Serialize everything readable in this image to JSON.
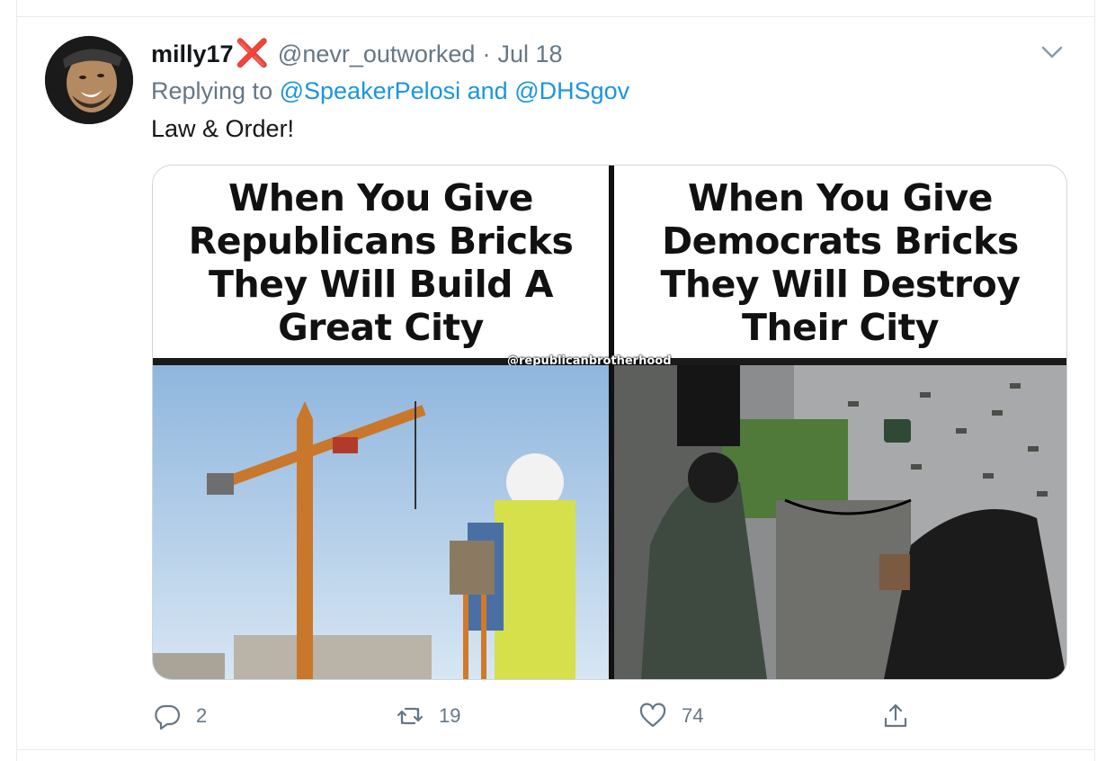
{
  "tweet": {
    "display_name": "milly17",
    "name_emoji": "❌",
    "handle": "@nevr_outworked",
    "separator": "·",
    "date": "Jul 18",
    "replying_prefix": "Replying to",
    "reply_to_1": "@SpeakerPelosi",
    "reply_joiner": "and",
    "reply_to_2": "@DHSgov",
    "text": "Law & Order!"
  },
  "media": {
    "left_caption": "When You Give\nRepublicans Bricks\nThey Will Build A\nGreat City",
    "right_caption": "When You Give\nDemocrats Bricks\nThey Will Destroy\nTheir City",
    "watermark": "@republicanbrotherhood",
    "left_photo": "construction crane with surveyor in hard hat",
    "right_photo": "masked protesters holding bricks on street"
  },
  "actions": {
    "reply_count": "2",
    "retweet_count": "19",
    "like_count": "74",
    "reply_icon": "speech-bubble-icon",
    "retweet_icon": "retweet-icon",
    "like_icon": "heart-icon",
    "share_icon": "share-icon"
  },
  "colors": {
    "link": "#1b95e0",
    "secondary_text": "#657786",
    "primary_text": "#14171a",
    "emoji_red": "#e0245e"
  }
}
